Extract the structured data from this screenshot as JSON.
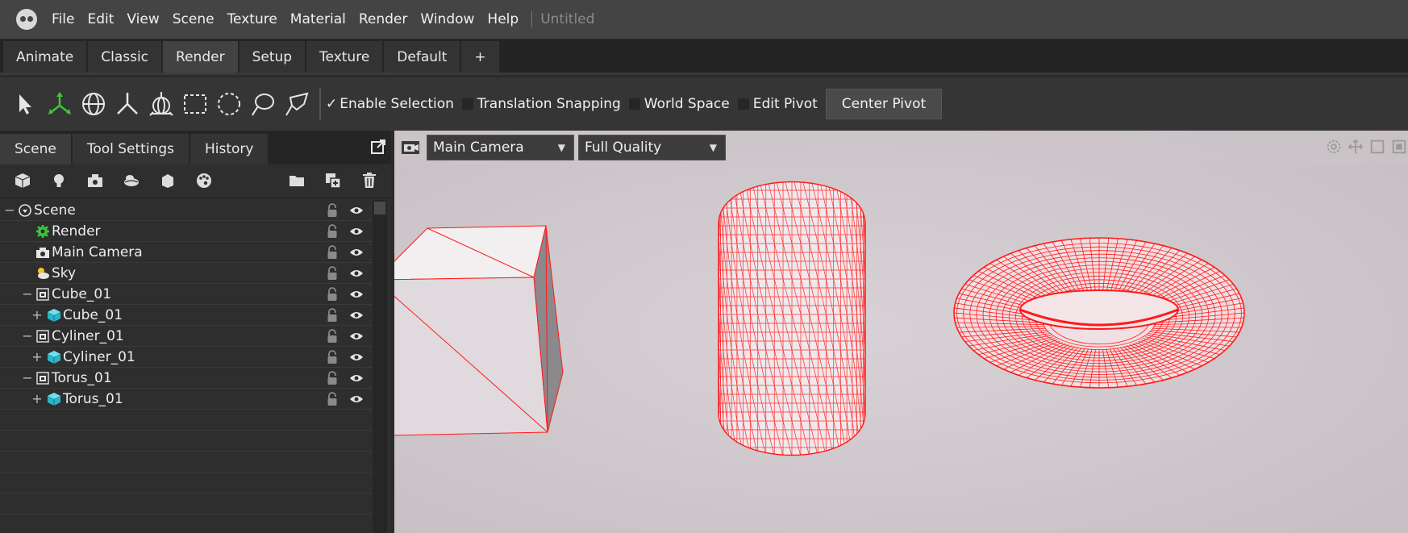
{
  "app": {
    "logo_icon": "skull-logo-icon",
    "menu": [
      "File",
      "Edit",
      "View",
      "Scene",
      "Texture",
      "Material",
      "Render",
      "Window",
      "Help"
    ],
    "separator": "|",
    "document_title": "Untitled"
  },
  "workspace_tabs": [
    {
      "label": "Animate",
      "active": false
    },
    {
      "label": "Classic",
      "active": false
    },
    {
      "label": "Render",
      "active": true
    },
    {
      "label": "Setup",
      "active": false
    },
    {
      "label": "Texture",
      "active": false
    },
    {
      "label": "Default",
      "active": false
    },
    {
      "label": "+",
      "active": false
    }
  ],
  "toolbar": {
    "tools": [
      "select-arrow-icon",
      "move-gizmo-icon",
      "rotate-gizmo-icon",
      "scale-gizmo-icon",
      "universal-gizmo-icon",
      "rect-select-icon",
      "circle-select-icon",
      "lasso-select-icon",
      "polygon-lasso-icon"
    ],
    "enable_selection": {
      "label": "Enable Selection",
      "checked": true,
      "mark": "✓"
    },
    "translation_snapping": {
      "label": "Translation Snapping",
      "checked": false
    },
    "world_space": {
      "label": "World Space",
      "checked": false
    },
    "edit_pivot": {
      "label": "Edit Pivot",
      "checked": false
    },
    "center_pivot": "Center Pivot"
  },
  "left_panel": {
    "tabs": [
      {
        "label": "Scene",
        "active": true
      },
      {
        "label": "Tool Settings",
        "active": false
      },
      {
        "label": "History",
        "active": false
      }
    ],
    "popout_icon": "popout-icon",
    "create_icons": [
      "cube-icon",
      "light-bulb-icon",
      "camera-icon",
      "sky-icon",
      "material-icon",
      "palette-icon"
    ],
    "action_icons": [
      "folder-icon",
      "duplicate-icon",
      "trash-icon"
    ],
    "tree": [
      {
        "label": "Scene",
        "prefix": "−",
        "icon": "scene-icon"
      },
      {
        "label": "Render",
        "prefix": "",
        "icon": "render-gear-icon"
      },
      {
        "label": "Main Camera",
        "prefix": "",
        "icon": "camera-icon"
      },
      {
        "label": "Sky",
        "prefix": "",
        "icon": "sky-icon"
      },
      {
        "label": "Cube_01",
        "prefix": "−",
        "icon": "group-icon"
      },
      {
        "label": "Cube_01",
        "prefix": "+",
        "icon": "mesh-icon"
      },
      {
        "label": "Cyliner_01",
        "prefix": "−",
        "icon": "group-icon"
      },
      {
        "label": "Cyliner_01",
        "prefix": "+",
        "icon": "mesh-icon"
      },
      {
        "label": "Torus_01",
        "prefix": "−",
        "icon": "group-icon"
      },
      {
        "label": "Torus_01",
        "prefix": "+",
        "icon": "mesh-icon"
      }
    ]
  },
  "viewport": {
    "camera_icon": "viewport-camera-icon",
    "camera_select": "Main Camera",
    "quality_select": "Full Quality",
    "corner_icons": [
      "settings-icon",
      "move-view-icon",
      "maximize-icon",
      "layout-icon"
    ],
    "wire_color": "#ff1a1a",
    "background_color": "#cfc8cc"
  },
  "colors": {
    "menubar": "#444444",
    "panel": "#2e2e2e",
    "accent_green": "#3fc43f"
  }
}
